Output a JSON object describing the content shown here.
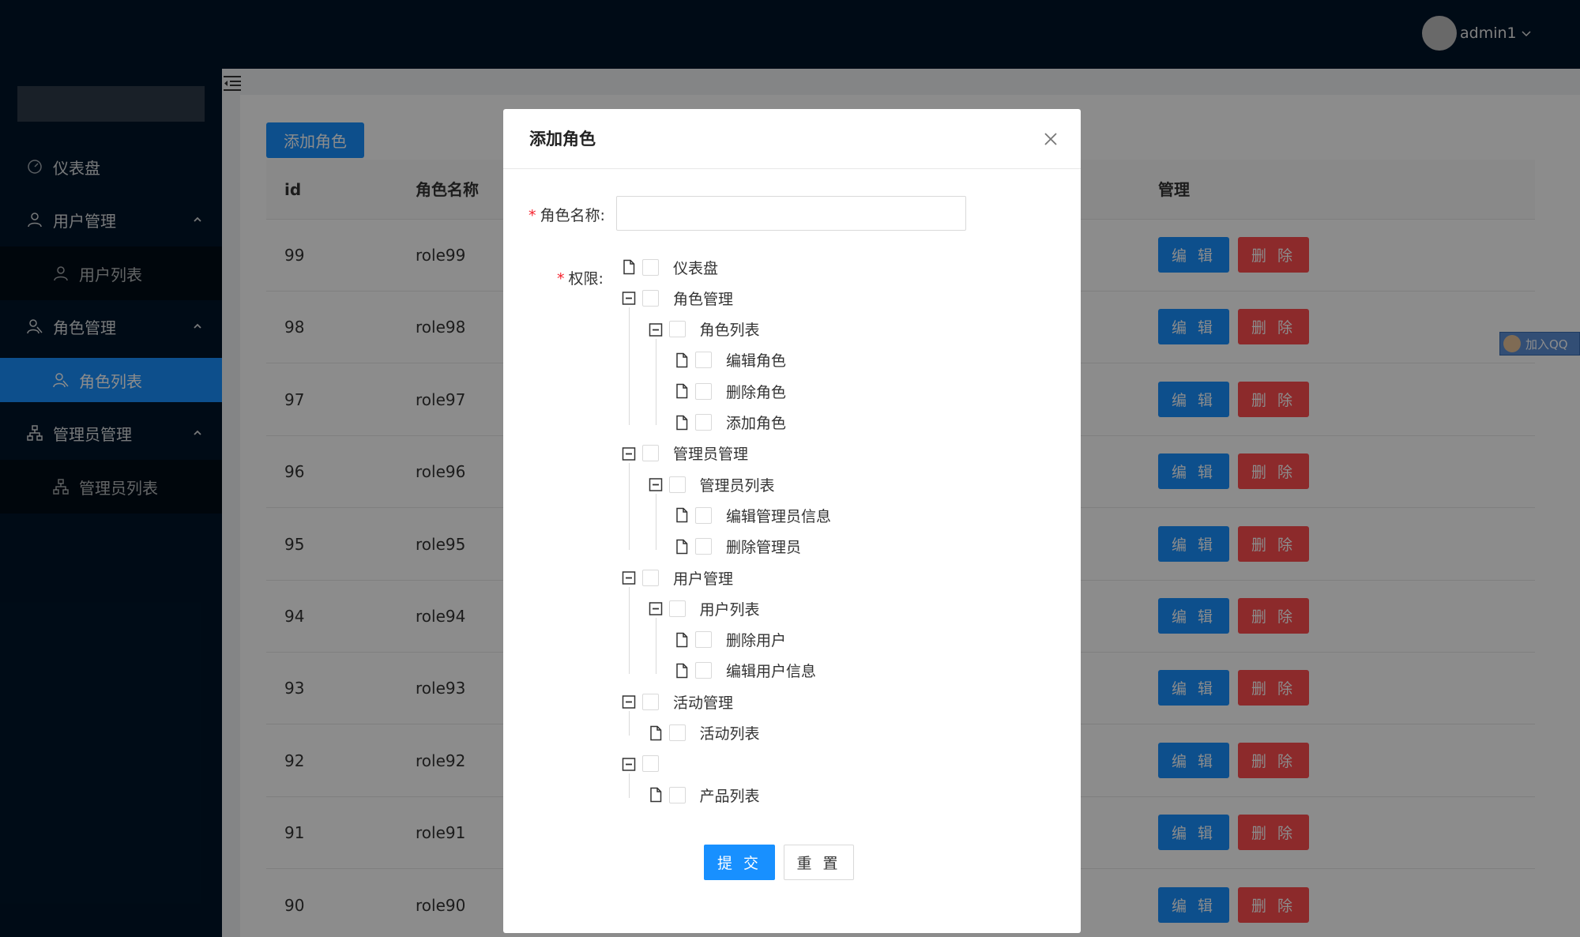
{
  "header": {
    "username": "admin1"
  },
  "sidebar": {
    "items": [
      {
        "label": "仪表盘"
      },
      {
        "label": "用户管理"
      },
      {
        "label": "用户列表"
      },
      {
        "label": "角色管理"
      },
      {
        "label": "角色列表"
      },
      {
        "label": "管理员管理"
      },
      {
        "label": "管理员列表"
      }
    ]
  },
  "toolbar": {
    "add_label": "添加角色"
  },
  "table": {
    "headers": {
      "id": "id",
      "name": "角色名称",
      "manage": "管理"
    },
    "edit_label": "编 辑",
    "delete_label": "删 除",
    "rows": [
      {
        "id": "99",
        "name": "role99"
      },
      {
        "id": "98",
        "name": "role98"
      },
      {
        "id": "97",
        "name": "role97"
      },
      {
        "id": "96",
        "name": "role96"
      },
      {
        "id": "95",
        "name": "role95"
      },
      {
        "id": "94",
        "name": "role94"
      },
      {
        "id": "93",
        "name": "role93"
      },
      {
        "id": "92",
        "name": "role92"
      },
      {
        "id": "91",
        "name": "role91"
      },
      {
        "id": "90",
        "name": "role90"
      }
    ]
  },
  "qq_badge": "加入QQ",
  "modal": {
    "title": "添加角色",
    "name_label": "角色名称:",
    "name_value": "",
    "perm_label": "权限:",
    "tree": [
      {
        "label": "仪表盘"
      },
      {
        "label": "角色管理"
      },
      {
        "label": "角色列表"
      },
      {
        "label": "编辑角色"
      },
      {
        "label": "删除角色"
      },
      {
        "label": "添加角色"
      },
      {
        "label": "管理员管理"
      },
      {
        "label": "管理员列表"
      },
      {
        "label": "编辑管理员信息"
      },
      {
        "label": "删除管理员"
      },
      {
        "label": "用户管理"
      },
      {
        "label": "用户列表"
      },
      {
        "label": "删除用户"
      },
      {
        "label": "编辑用户信息"
      },
      {
        "label": "活动管理"
      },
      {
        "label": "活动列表"
      },
      {
        "label": ""
      },
      {
        "label": "产品列表"
      }
    ],
    "submit_label": "提 交",
    "reset_label": "重 置"
  },
  "colors": {
    "primary": "#1890ff",
    "danger": "#ff4d4f",
    "sider": "#001529"
  }
}
